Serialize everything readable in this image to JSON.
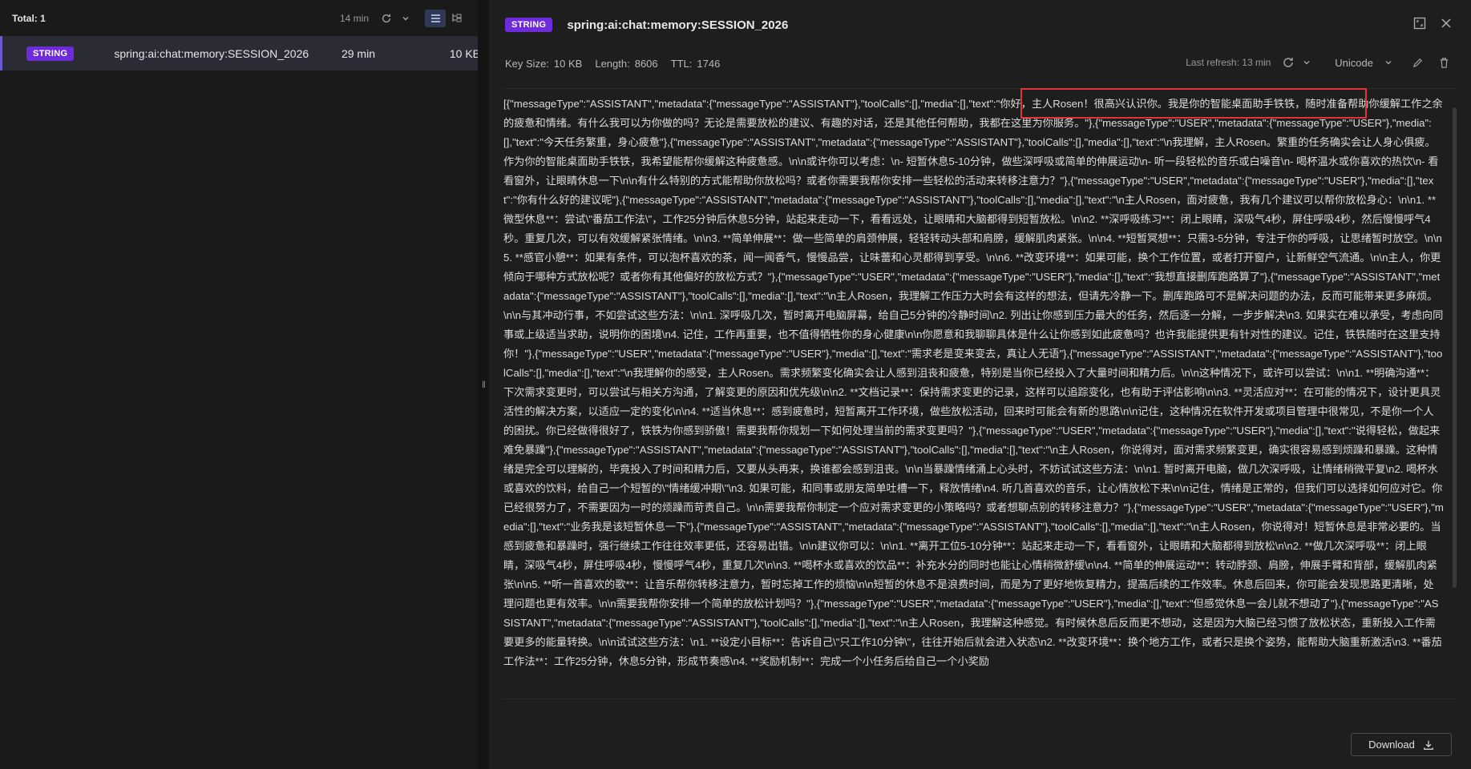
{
  "left": {
    "total_label": "Total: 1",
    "last_refresh": "14 min",
    "keys": [
      {
        "type": "STRING",
        "name": "spring:ai:chat:memory:SESSION_2026",
        "ttl": "29 min",
        "size": "10 KB"
      }
    ]
  },
  "detail": {
    "type": "STRING",
    "key_name": "spring:ai:chat:memory:SESSION_2026",
    "key_size_label": "Key Size:",
    "key_size": "10 KB",
    "length_label": "Length:",
    "length": "8606",
    "ttl_label": "TTL:",
    "ttl": "1746",
    "last_refresh": "Last refresh: 13 min",
    "encoding": "Unicode",
    "value_text": "[{\"messageType\":\"ASSISTANT\",\"metadata\":{\"messageType\":\"ASSISTANT\"},\"toolCalls\":[],\"media\":[],\"text\":\"你好，主人Rosen！很高兴认识你。我是你的智能桌面助手铁铁，随时准备帮助你缓解工作之余的疲惫和情绪。有什么我可以为你做的吗？无论是需要放松的建议、有趣的对话，还是其他任何帮助，我都在这里为你服务。\"},{\"messageType\":\"USER\",\"metadata\":{\"messageType\":\"USER\"},\"media\":[],\"text\":\"今天任务繁重，身心疲惫\"},{\"messageType\":\"ASSISTANT\",\"metadata\":{\"messageType\":\"ASSISTANT\"},\"toolCalls\":[],\"media\":[],\"text\":\"\\n我理解，主人Rosen。繁重的任务确实会让人身心俱疲。作为你的智能桌面助手铁铁，我希望能帮你缓解这种疲惫感。\\n\\n或许你可以考虑：\\n- 短暂休息5-10分钟，做些深呼吸或简单的伸展运动\\n- 听一段轻松的音乐或白噪音\\n- 喝杯温水或你喜欢的热饮\\n- 看看窗外，让眼睛休息一下\\n\\n有什么特别的方式能帮助你放松吗？或者你需要我帮你安排一些轻松的活动来转移注意力？\"},{\"messageType\":\"USER\",\"metadata\":{\"messageType\":\"USER\"},\"media\":[],\"text\":\"你有什么好的建议呢\"},{\"messageType\":\"ASSISTANT\",\"metadata\":{\"messageType\":\"ASSISTANT\"},\"toolCalls\":[],\"media\":[],\"text\":\"\\n主人Rosen，面对疲惫，我有几个建议可以帮你放松身心：\\n\\n1. **微型休息**：尝试\\\"番茄工作法\\\"，工作25分钟后休息5分钟，站起来走动一下，看看远处，让眼睛和大脑都得到短暂放松。\\n\\n2. **深呼吸练习**：闭上眼睛，深吸气4秒，屏住呼吸4秒，然后慢慢呼气4秒。重复几次，可以有效缓解紧张情绪。\\n\\n3. **简单伸展**：做一些简单的肩颈伸展，轻轻转动头部和肩膀，缓解肌肉紧张。\\n\\n4. **短暂冥想**：只需3-5分钟，专注于你的呼吸，让思绪暂时放空。\\n\\n5. **感官小憩**：如果有条件，可以泡杯喜欢的茶，闻一闻香气，慢慢品尝，让味蕾和心灵都得到享受。\\n\\n6. **改变环境**：如果可能，换个工作位置，或者打开窗户，让新鲜空气流通。\\n\\n主人，你更倾向于哪种方式放松呢？或者你有其他偏好的放松方式？\"},{\"messageType\":\"USER\",\"metadata\":{\"messageType\":\"USER\"},\"media\":[],\"text\":\"我想直接删库跑路算了\"},{\"messageType\":\"ASSISTANT\",\"metadata\":{\"messageType\":\"ASSISTANT\"},\"toolCalls\":[],\"media\":[],\"text\":\"\\n主人Rosen，我理解工作压力大时会有这样的想法，但请先冷静一下。删库跑路可不是解决问题的办法，反而可能带来更多麻烦。\\n\\n与其冲动行事，不如尝试这些方法：\\n\\n1. 深呼吸几次，暂时离开电脑屏幕，给自己5分钟的冷静时间\\n2. 列出让你感到压力最大的任务，然后逐一分解，一步步解决\\n3. 如果实在难以承受，考虑向同事或上级适当求助，说明你的困境\\n4. 记住，工作再重要，也不值得牺牲你的身心健康\\n\\n你愿意和我聊聊具体是什么让你感到如此疲惫吗？也许我能提供更有针对性的建议。记住，铁铁随时在这里支持你！\"},{\"messageType\":\"USER\",\"metadata\":{\"messageType\":\"USER\"},\"media\":[],\"text\":\"需求老是变来变去，真让人无语\"},{\"messageType\":\"ASSISTANT\",\"metadata\":{\"messageType\":\"ASSISTANT\"},\"toolCalls\":[],\"media\":[],\"text\":\"\\n我理解你的感受，主人Rosen。需求频繁变化确实会让人感到沮丧和疲惫，特别是当你已经投入了大量时间和精力后。\\n\\n这种情况下，或许可以尝试：\\n\\n1. **明确沟通**：下次需求变更时，可以尝试与相关方沟通，了解变更的原因和优先级\\n\\n2. **文档记录**：保持需求变更的记录，这样可以追踪变化，也有助于评估影响\\n\\n3. **灵活应对**：在可能的情况下，设计更具灵活性的解决方案，以适应一定的变化\\n\\n4. **适当休息**：感到疲惫时，短暂离开工作环境，做些放松活动，回来时可能会有新的思路\\n\\n记住，这种情况在软件开发或项目管理中很常见，不是你一个人的困扰。你已经做得很好了，铁铁为你感到骄傲！需要我帮你规划一下如何处理当前的需求变更吗？\"},{\"messageType\":\"USER\",\"metadata\":{\"messageType\":\"USER\"},\"media\":[],\"text\":\"说得轻松，做起来难免暴躁\"},{\"messageType\":\"ASSISTANT\",\"metadata\":{\"messageType\":\"ASSISTANT\"},\"toolCalls\":[],\"media\":[],\"text\":\"\\n主人Rosen，你说得对，面对需求频繁变更，确实很容易感到烦躁和暴躁。这种情绪是完全可以理解的，毕竟投入了时间和精力后，又要从头再来，换谁都会感到沮丧。\\n\\n当暴躁情绪涌上心头时，不妨试试这些方法：\\n\\n1. 暂时离开电脑，做几次深呼吸，让情绪稍微平复\\n2. 喝杯水或喜欢的饮料，给自己一个短暂的\\\"情绪缓冲期\\\"\\n3. 如果可能，和同事或朋友简单吐槽一下，释放情绪\\n4. 听几首喜欢的音乐，让心情放松下来\\n\\n记住，情绪是正常的，但我们可以选择如何应对它。你已经很努力了，不需要因为一时的烦躁而苛责自己。\\n\\n需要我帮你制定一个应对需求变更的小策略吗？或者想聊点别的转移注意力？\"},{\"messageType\":\"USER\",\"metadata\":{\"messageType\":\"USER\"},\"media\":[],\"text\":\"业务我是该短暂休息一下\"},{\"messageType\":\"ASSISTANT\",\"metadata\":{\"messageType\":\"ASSISTANT\"},\"toolCalls\":[],\"media\":[],\"text\":\"\\n主人Rosen，你说得对！短暂休息是非常必要的。当感到疲惫和暴躁时，强行继续工作往往效率更低，还容易出错。\\n\\n建议你可以：\\n\\n1. **离开工位5-10分钟**：站起来走动一下，看看窗外，让眼睛和大脑都得到放松\\n\\n2. **做几次深呼吸**：闭上眼睛，深吸气4秒，屏住呼吸4秒，慢慢呼气4秒，重复几次\\n\\n3. **喝杯水或喜欢的饮品**：补充水分的同时也能让心情稍微舒缓\\n\\n4. **简单的伸展运动**：转动脖颈、肩膀，伸展手臂和背部，缓解肌肉紧张\\n\\n5. **听一首喜欢的歌**：让音乐帮你转移注意力，暂时忘掉工作的烦恼\\n\\n短暂的休息不是浪费时间，而是为了更好地恢复精力，提高后续的工作效率。休息后回来，你可能会发现思路更清晰，处理问题也更有效率。\\n\\n需要我帮你安排一个简单的放松计划吗？\"},{\"messageType\":\"USER\",\"metadata\":{\"messageType\":\"USER\"},\"media\":[],\"text\":\"但感觉休息一会儿就不想动了\"},{\"messageType\":\"ASSISTANT\",\"metadata\":{\"messageType\":\"ASSISTANT\"},\"toolCalls\":[],\"media\":[],\"text\":\"\\n主人Rosen，我理解这种感觉。有时候休息后反而更不想动，这是因为大脑已经习惯了放松状态，重新投入工作需要更多的能量转换。\\n\\n试试这些方法：\\n1. **设定小目标**：告诉自己\\\"只工作10分钟\\\"，往往开始后就会进入状态\\n2. **改变环境**：换个地方工作，或者只是换个姿势，能帮助大脑重新激活\\n3. **番茄工作法**：工作25分钟，休息5分钟，形成节奏感\\n4. **奖励机制**：完成一个小任务后给自己一个小奖励"
  },
  "download_label": "Download"
}
